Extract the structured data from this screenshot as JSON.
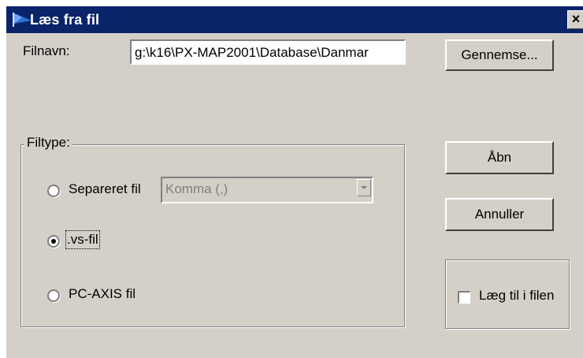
{
  "window": {
    "title": "Læs fra fil",
    "close_glyph": "×"
  },
  "filename": {
    "label": "Filnavn:",
    "value": "g:\\k16\\PX-MAP2001\\Database\\Danmar"
  },
  "buttons": {
    "browse": "Gennemse...",
    "open": "Åbn",
    "cancel": "Annuller"
  },
  "filetype": {
    "legend": "Filtype:",
    "options": [
      {
        "label": "Separeret fil",
        "selected": false
      },
      {
        "label": ".vs-fil",
        "selected": true
      },
      {
        "label": "PC-AXIS fil",
        "selected": false
      }
    ],
    "separator": {
      "selected_value": "Komma (,)",
      "enabled": false
    }
  },
  "append": {
    "label": "Læg til i filen",
    "checked": false
  },
  "icons": {
    "title": "app-flag-icon",
    "close": "close-icon",
    "dropdown": "chevron-down-icon"
  },
  "colors": {
    "titlebar": "#0a246a",
    "dialog_bg": "#d4d0c8",
    "disabled_text": "#808080"
  }
}
